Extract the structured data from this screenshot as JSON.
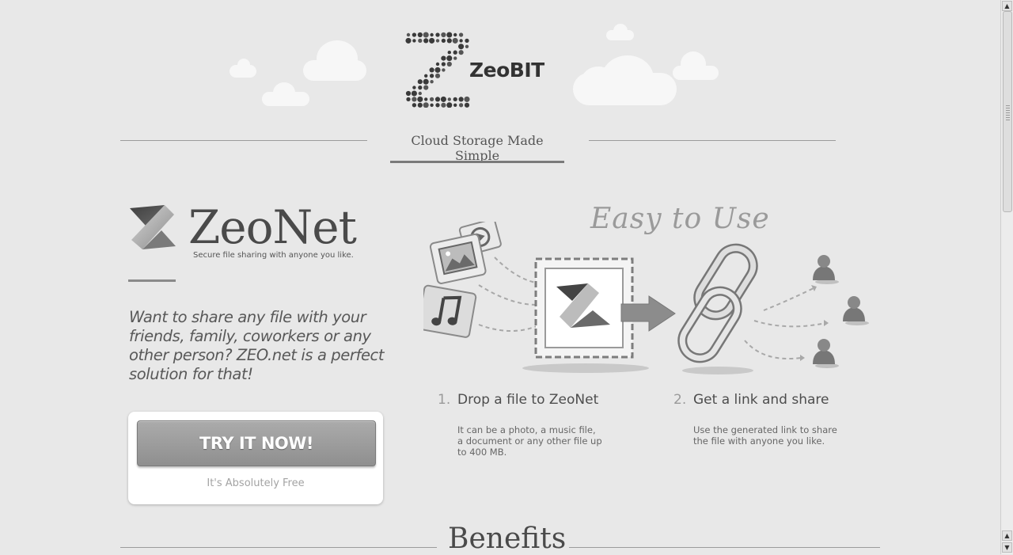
{
  "header": {
    "brand_name": "ZeoBIT",
    "tagline": "Cloud Storage Made Simple"
  },
  "hero": {
    "product_name": "ZeoNet",
    "product_subtitle": "Secure file sharing with anyone you like.",
    "pitch": "Want to share any file with your friends, family, coworkers or any other person? ZEO.net is a perfect solution for that!",
    "cta_label": "TRY IT NOW!",
    "cta_note": "It's Absolutely Free"
  },
  "how_it_works": {
    "heading": "Easy to Use",
    "steps": [
      {
        "number": "1.",
        "title": "Drop a file to ZeoNet",
        "description": "It can be a photo, a music file, a document or any other file up to 400 MB."
      },
      {
        "number": "2.",
        "title": "Get a link and share",
        "description": "Use the generated link to share the file with anyone you like."
      }
    ]
  },
  "benefits": {
    "heading": "Benefits"
  },
  "icons": [
    "zeobit-logo-icon",
    "zeonet-logo-icon",
    "photo-file-icon",
    "video-file-icon",
    "music-file-icon",
    "drop-zone-icon",
    "arrow-right-icon",
    "chain-link-icon",
    "user-icon"
  ],
  "colors": {
    "background": "#e8e8e8",
    "button": "#9d9d9d",
    "text": "#555555"
  }
}
